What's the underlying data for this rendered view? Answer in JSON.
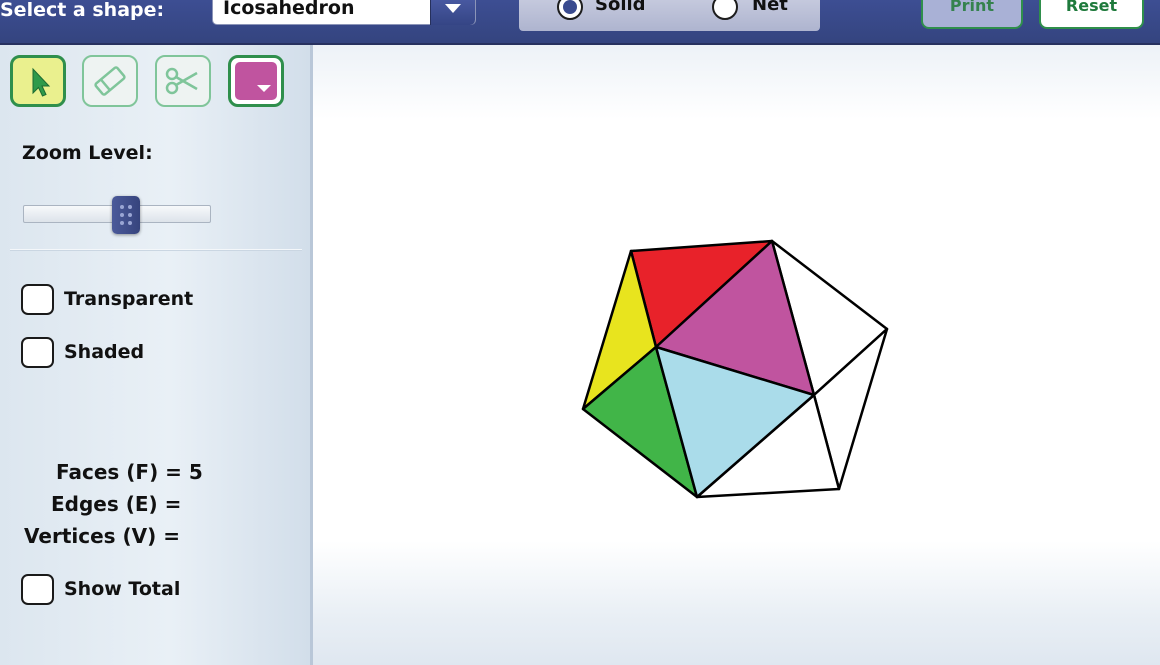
{
  "header": {
    "shape_label": "Select a shape:",
    "shape_value": "Icosahedron",
    "view_modes": [
      {
        "label": "Solid",
        "checked": true
      },
      {
        "label": "Net",
        "checked": false
      }
    ],
    "print_label": "Print",
    "reset_label": "Reset"
  },
  "toolbar": {
    "tools": [
      "select-arrow-icon",
      "eraser-icon",
      "scissors-icon",
      "color-picker"
    ],
    "active_tool": "select-arrow-icon",
    "paint_color": "#c0549f"
  },
  "zoom": {
    "label": "Zoom Level:",
    "level": 0.55
  },
  "options": {
    "transparent": {
      "label": "Transparent",
      "checked": false
    },
    "shaded": {
      "label": "Shaded",
      "checked": false
    },
    "show_total": {
      "label": "Show Total",
      "checked": false
    }
  },
  "stats": {
    "faces": "Faces (F) = 5",
    "edges": "Edges (E) =",
    "vertices": "Vertices (V) ="
  },
  "faces": [
    {
      "name": "face-red",
      "color": "#e8222a"
    },
    {
      "name": "face-magenta",
      "color": "#c0549f"
    },
    {
      "name": "face-yellow",
      "color": "#e8e41e"
    },
    {
      "name": "face-green",
      "color": "#41b548"
    },
    {
      "name": "face-light-blue",
      "color": "#aadcea"
    }
  ],
  "colors": {
    "header_bg": "#3a4a8a",
    "accent_green": "#2f8f4c",
    "edge": "#000000"
  }
}
